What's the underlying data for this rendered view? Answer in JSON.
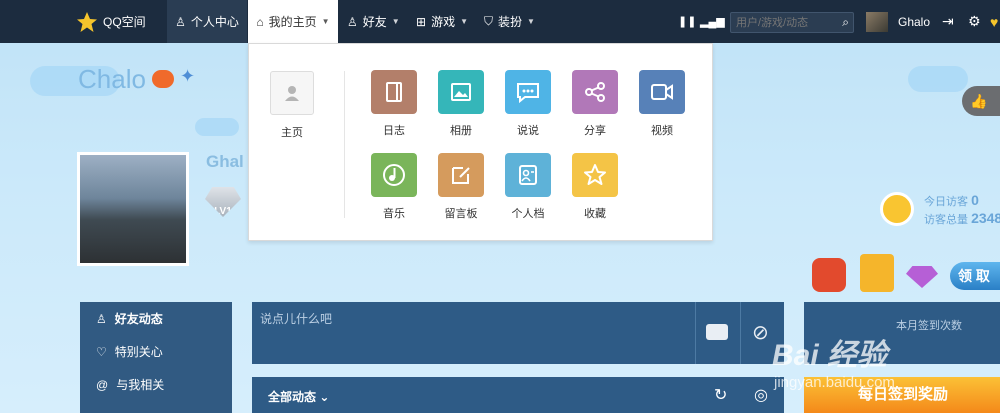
{
  "topnav": {
    "logo_text": "QQ空间",
    "items": [
      {
        "label": "个人中心",
        "icon": "person-icon"
      },
      {
        "label": "我的主页",
        "icon": "home-icon"
      },
      {
        "label": "好友",
        "icon": "friends-icon"
      },
      {
        "label": "游戏",
        "icon": "grid-icon"
      },
      {
        "label": "装扮",
        "icon": "shirt-icon"
      }
    ],
    "search_placeholder": "用户/游戏/动态",
    "username": "Ghalo"
  },
  "dropdown": {
    "home_label": "主页",
    "apps": [
      {
        "label": "日志",
        "color": "#b37f6a"
      },
      {
        "label": "相册",
        "color": "#35b6b9"
      },
      {
        "label": "说说",
        "color": "#4fb4e6"
      },
      {
        "label": "分享",
        "color": "#b178b8"
      },
      {
        "label": "视频",
        "color": "#5781b8"
      },
      {
        "label": "音乐",
        "color": "#7ab55a"
      },
      {
        "label": "留言板",
        "color": "#d59b5d"
      },
      {
        "label": "个人档",
        "color": "#5eb2d8"
      },
      {
        "label": "收藏",
        "color": "#f4c446"
      }
    ]
  },
  "profile": {
    "name": "Chalo",
    "name_secondary": "Ghal",
    "level": "LV1"
  },
  "visitors": {
    "today_label": "今日访客",
    "today_value": "0",
    "total_label": "访客总量",
    "total_value": "2348"
  },
  "rewards": {
    "receive_label": "领 取"
  },
  "leftmenu": {
    "items": [
      {
        "label": "好友动态",
        "icon": "person-icon"
      },
      {
        "label": "特别关心",
        "icon": "heart-icon"
      },
      {
        "label": "与我相关",
        "icon": "at-icon"
      }
    ]
  },
  "post": {
    "placeholder": "说点儿什么吧"
  },
  "feed": {
    "filter_label": "全部动态"
  },
  "sign": {
    "month_label": "本月签到次数",
    "banner_text": "每日签到奖励"
  },
  "watermark": {
    "brand": "Bai 经验",
    "url": "jingyan.baidu.com"
  }
}
